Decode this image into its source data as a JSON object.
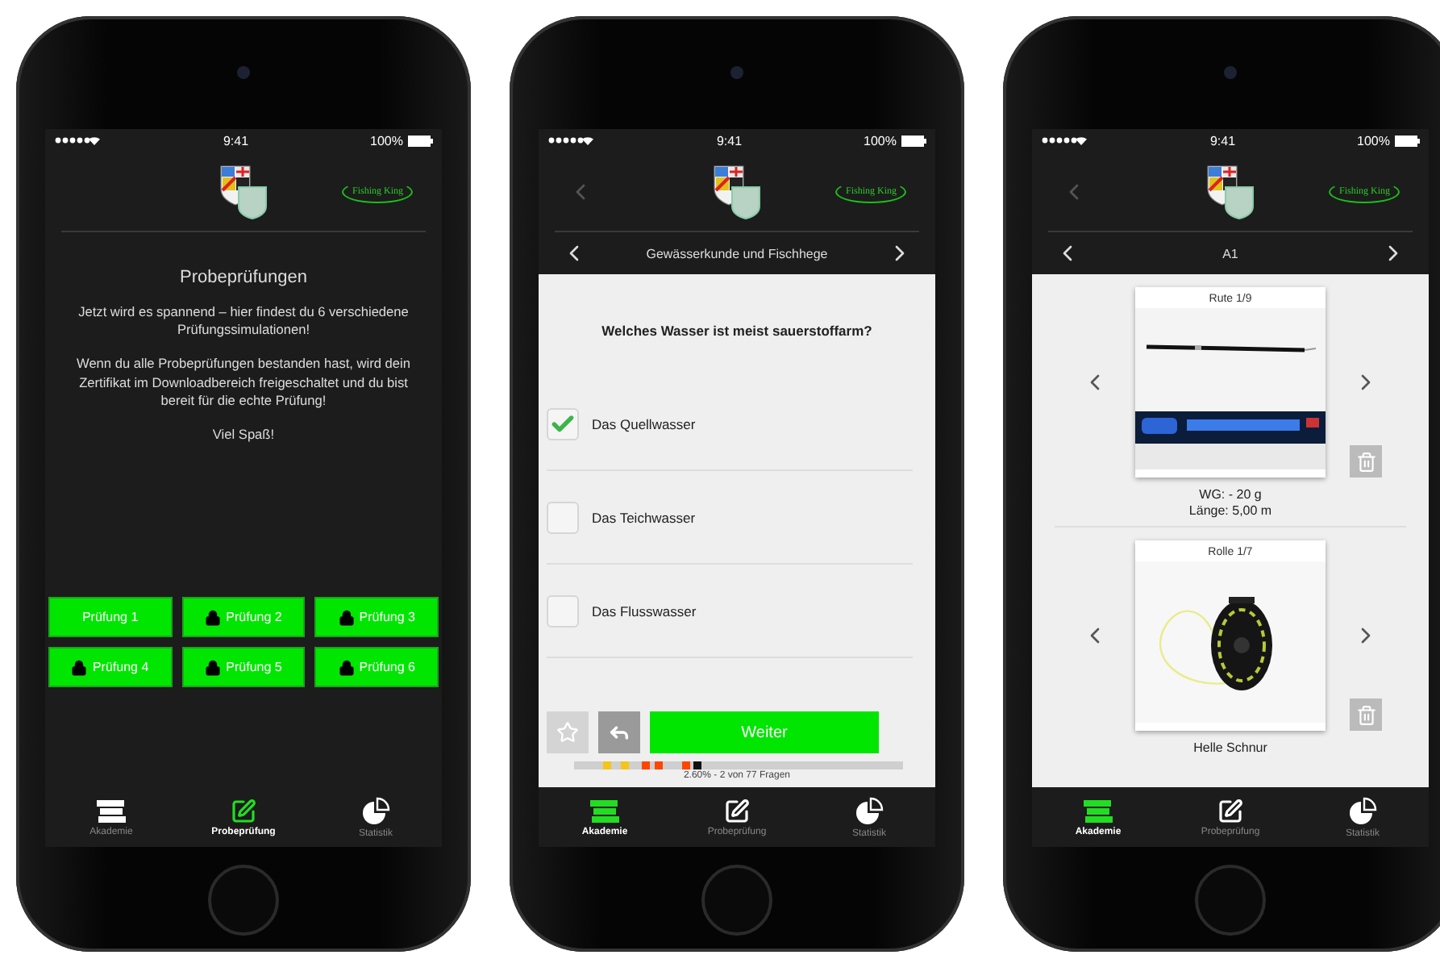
{
  "phones": [
    {
      "kind": "exams",
      "status": {
        "time": "9:41",
        "battery": "100%"
      },
      "header": {
        "show_back": false,
        "logo": "Fishing King"
      },
      "title": "Probeprüfungen",
      "paragraphs": [
        "Jetzt wird es spannend – hier findest du 6 verschiedene Prüfungssimulationen!",
        "Wenn du alle Probeprüfungen bestanden hast, wird dein Zertifikat im Downloadbereich freigeschaltet und du bist bereit für die echte Prüfung!",
        "Viel Spaß!"
      ],
      "exams": [
        {
          "label": "Prüfung 1",
          "locked": false
        },
        {
          "label": "Prüfung 2",
          "locked": true
        },
        {
          "label": "Prüfung 3",
          "locked": true
        },
        {
          "label": "Prüfung 4",
          "locked": true
        },
        {
          "label": "Prüfung 5",
          "locked": true
        },
        {
          "label": "Prüfung 6",
          "locked": true
        }
      ],
      "tabs": [
        {
          "label": "Akademie",
          "selected": false
        },
        {
          "label": "Probeprüfung",
          "selected": true
        },
        {
          "label": "Statistik",
          "selected": false
        }
      ]
    },
    {
      "kind": "quiz",
      "status": {
        "time": "9:41",
        "battery": "100%"
      },
      "header": {
        "show_back": true,
        "logo": "Fishing King"
      },
      "subnav": "Gewässerkunde und Fischhege",
      "question": "Welches Wasser ist meist sauerstoffarm?",
      "answers": [
        {
          "label": "Das Quellwasser",
          "checked": true
        },
        {
          "label": "Das Teichwasser",
          "checked": false
        },
        {
          "label": "Das Flusswasser",
          "checked": false
        }
      ],
      "next_button": "Weiter",
      "progress": {
        "label": "2.60% - 2 von 77 Fragen",
        "segments": [
          {
            "color": "#f5c518"
          },
          {
            "color": "#f5c518"
          },
          {
            "color": "#ff4500"
          },
          {
            "color": "#ff4500"
          },
          {
            "color": "#ff4500"
          },
          {
            "color": "#111111"
          }
        ]
      },
      "tabs": [
        {
          "label": "Akademie",
          "selected": true
        },
        {
          "label": "Probeprüfung",
          "selected": false
        },
        {
          "label": "Statistik",
          "selected": false
        }
      ]
    },
    {
      "kind": "equipment",
      "status": {
        "time": "9:41",
        "battery": "100%"
      },
      "header": {
        "show_back": true,
        "logo": "Fishing King"
      },
      "subnav": "A1",
      "items": [
        {
          "title": "Rute 1/9",
          "lines": [
            "WG: - 20 g",
            "Länge: 5,00 m"
          ]
        },
        {
          "title": "Rolle 1/7",
          "lines": [
            "Helle Schnur"
          ]
        }
      ],
      "tabs": [
        {
          "label": "Akademie",
          "selected": true
        },
        {
          "label": "Probeprüfung",
          "selected": false
        },
        {
          "label": "Statistik",
          "selected": false
        }
      ]
    }
  ]
}
